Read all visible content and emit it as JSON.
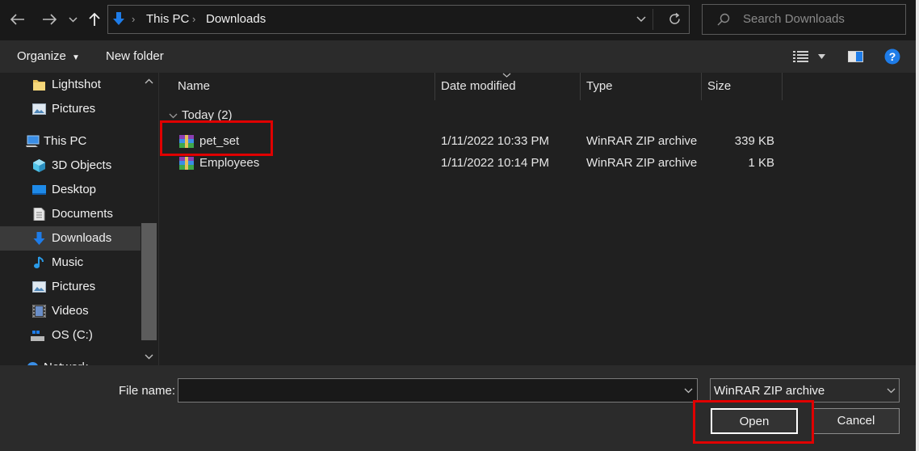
{
  "address_bar": {
    "crumbs": [
      "This PC",
      "Downloads"
    ],
    "search_placeholder": "Search Downloads"
  },
  "toolbar": {
    "organize_label": "Organize",
    "new_folder_label": "New folder"
  },
  "nav_pane": {
    "items": [
      {
        "label": "Lightshot",
        "icon": "folder-icon"
      },
      {
        "label": "Pictures",
        "icon": "pictures-icon"
      },
      {
        "label": "This PC",
        "icon": "this-pc-icon"
      },
      {
        "label": "3D Objects",
        "icon": "3d-objects-icon"
      },
      {
        "label": "Desktop",
        "icon": "desktop-icon"
      },
      {
        "label": "Documents",
        "icon": "documents-icon"
      },
      {
        "label": "Downloads",
        "icon": "downloads-icon"
      },
      {
        "label": "Music",
        "icon": "music-icon"
      },
      {
        "label": "Pictures",
        "icon": "pictures-icon"
      },
      {
        "label": "Videos",
        "icon": "videos-icon"
      },
      {
        "label": "OS (C:)",
        "icon": "drive-icon"
      },
      {
        "label": "Network",
        "icon": "network-icon"
      }
    ]
  },
  "file_list": {
    "columns": [
      "Name",
      "Date modified",
      "Type",
      "Size"
    ],
    "group_label": "Today (2)",
    "rows": [
      {
        "name": "pet_set",
        "date": "1/11/2022 10:33 PM",
        "type": "WinRAR ZIP archive",
        "size": "339 KB"
      },
      {
        "name": "Employees",
        "date": "1/11/2022 10:14 PM",
        "type": "WinRAR ZIP archive",
        "size": "1 KB"
      }
    ]
  },
  "bottom_bar": {
    "file_name_label": "File name:",
    "file_name_value": "",
    "file_type_value": "WinRAR ZIP archive",
    "open_label": "Open",
    "cancel_label": "Cancel"
  },
  "colors": {
    "highlight": "#e00000",
    "accent_blue": "#1e7ce8"
  }
}
